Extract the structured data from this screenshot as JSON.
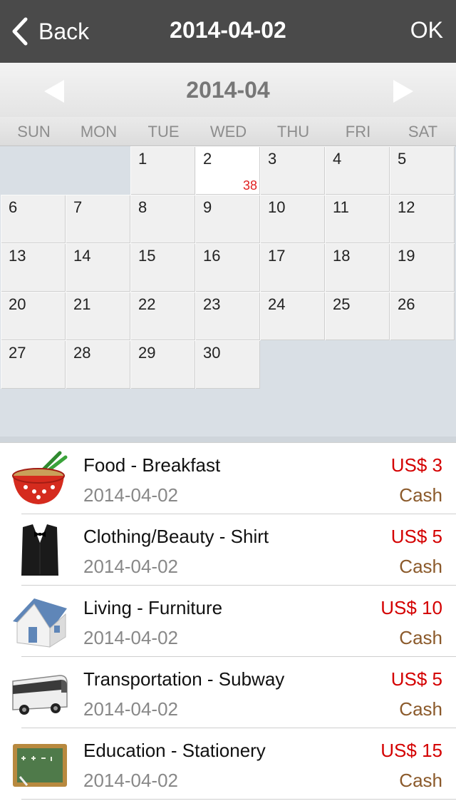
{
  "nav": {
    "back_label": "Back",
    "title": "2014-04-02",
    "ok_label": "OK"
  },
  "calendar": {
    "month_label": "2014-04",
    "weekdays": [
      "SUN",
      "MON",
      "TUE",
      "WED",
      "THU",
      "FRI",
      "SAT"
    ],
    "days": [
      "1",
      "2",
      "3",
      "4",
      "5",
      "6",
      "7",
      "8",
      "9",
      "10",
      "11",
      "12",
      "13",
      "14",
      "15",
      "16",
      "17",
      "18",
      "19",
      "20",
      "21",
      "22",
      "23",
      "24",
      "25",
      "26",
      "27",
      "28",
      "29",
      "30"
    ],
    "selected_day_badge": "38"
  },
  "transactions": [
    {
      "title": "Food - Breakfast",
      "date": "2014-04-02",
      "amount": "US$ 3",
      "method": "Cash",
      "icon": "noodle-bowl-icon"
    },
    {
      "title": "Clothing/Beauty - Shirt",
      "date": "2014-04-02",
      "amount": "US$ 5",
      "method": "Cash",
      "icon": "tuxedo-icon"
    },
    {
      "title": "Living - Furniture",
      "date": "2014-04-02",
      "amount": "US$ 10",
      "method": "Cash",
      "icon": "house-icon"
    },
    {
      "title": "Transportation - Subway",
      "date": "2014-04-02",
      "amount": "US$ 5",
      "method": "Cash",
      "icon": "bus-icon"
    },
    {
      "title": "Education - Stationery",
      "date": "2014-04-02",
      "amount": "US$ 15",
      "method": "Cash",
      "icon": "chalkboard-icon"
    }
  ],
  "colors": {
    "navbar": "#4a4a4a",
    "amount": "#d40000",
    "method": "#8b5a2b",
    "badge": "#e02020"
  }
}
